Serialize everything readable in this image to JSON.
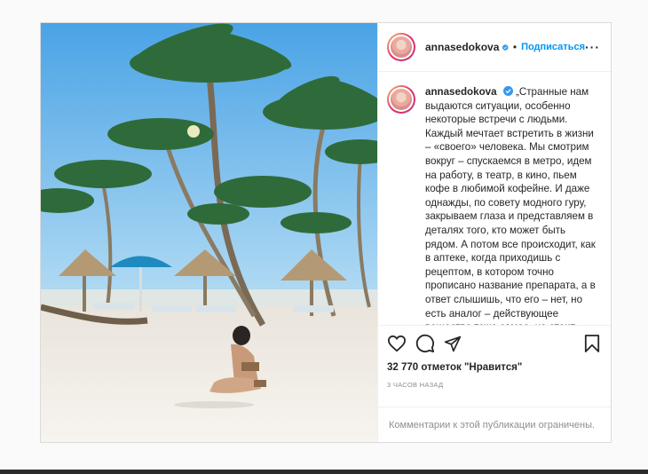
{
  "post": {
    "username": "annasedokova",
    "dot": "•",
    "follow_label": "Подписаться",
    "more_label": "···",
    "caption": "„Странные нам выдаются ситуации, особенно некоторые встречи с людьми. Каждый мечтает встретить в жизни – «своего» человека. Мы смотрим вокруг – спускаемся в метро, идем на работу, в театр, в кино, пьем кофе в любимой кофейне. И даже однажды, по совету модного гуру, закрываем глаза и представляем в деталях того, кто может быть рядом. А потом все происходит, как в аптеке, когда приходишь с рецептом, в котором точно прописано название препарата, а в ответ слышишь, что его – нет, но есть аналог – действующее вещество тоже самое, но стоит значительно дешевле. И соглашаешься. На аналог. Какое-то",
    "likes": "32 770 отметок \"Нравится\"",
    "time_ago": "3 часов назад",
    "comments_notice": "Комментарии к этой публикации ограничены."
  },
  "icons": {
    "verified": "verified-badge-icon",
    "like": "heart-icon",
    "comment": "comment-bubble-icon",
    "share": "paper-plane-icon",
    "save": "bookmark-icon"
  },
  "colors": {
    "accent": "#0095f6",
    "verified": "#3897f0",
    "border": "#dbdbdb",
    "muted": "#8e8e8e"
  }
}
